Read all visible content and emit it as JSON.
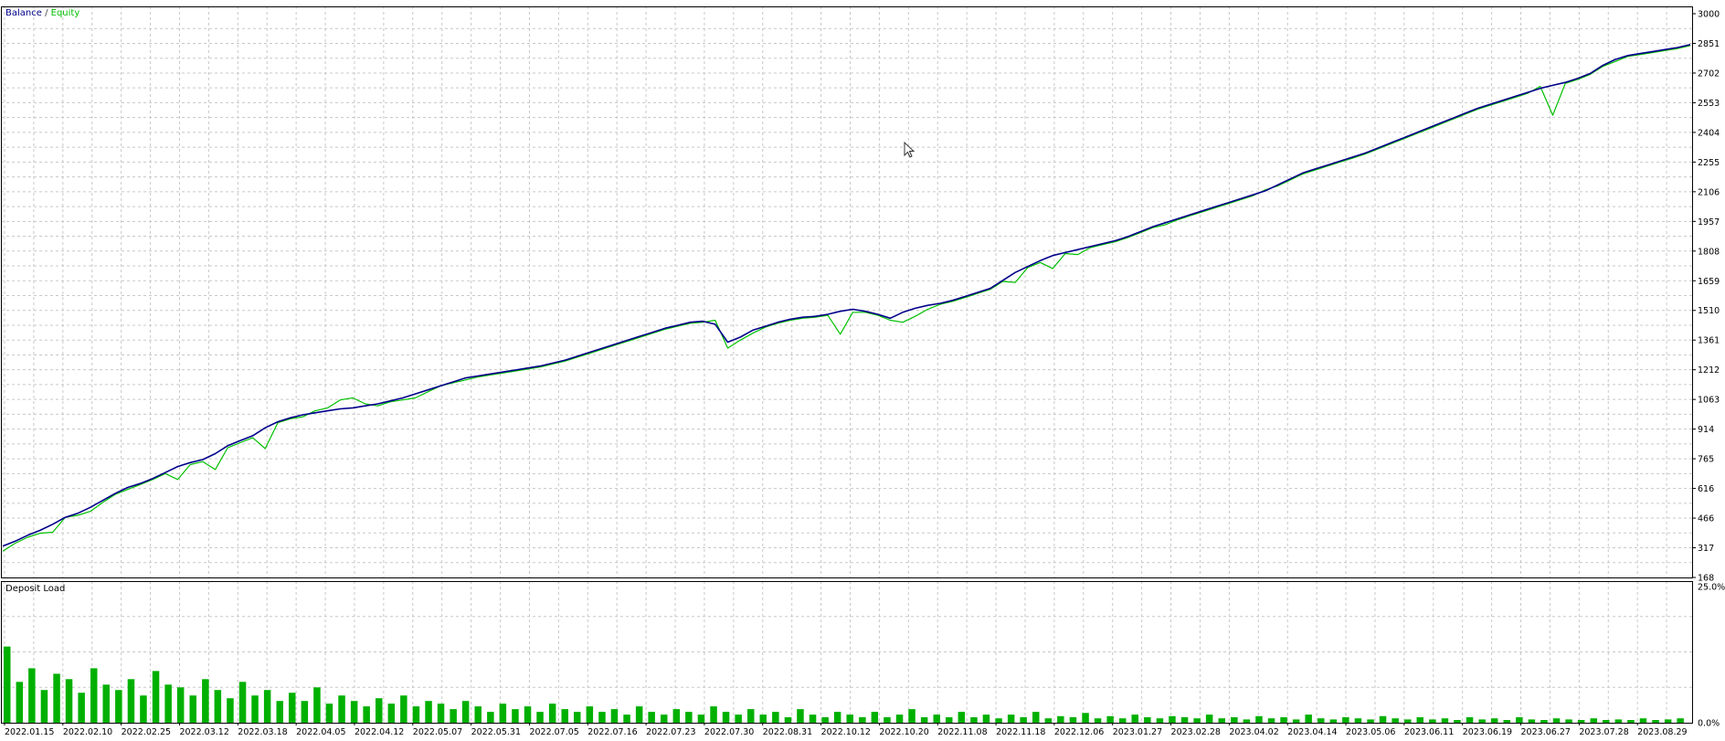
{
  "chart_data": [
    {
      "type": "line",
      "legend": {
        "placement": "top-left",
        "separator": " / "
      },
      "series": [
        {
          "name": "Balance",
          "color": "#00008b",
          "values": [
            325,
            350,
            380,
            405,
            435,
            470,
            490,
            520,
            555,
            590,
            620,
            640,
            665,
            695,
            725,
            745,
            760,
            790,
            830,
            855,
            880,
            920,
            950,
            970,
            985,
            995,
            1005,
            1015,
            1020,
            1030,
            1040,
            1055,
            1070,
            1090,
            1110,
            1130,
            1150,
            1170,
            1180,
            1190,
            1200,
            1210,
            1220,
            1230,
            1245,
            1260,
            1280,
            1300,
            1320,
            1340,
            1360,
            1380,
            1400,
            1420,
            1435,
            1450,
            1455,
            1440,
            1350,
            1375,
            1410,
            1430,
            1450,
            1465,
            1475,
            1480,
            1490,
            1505,
            1515,
            1505,
            1490,
            1470,
            1500,
            1520,
            1535,
            1545,
            1560,
            1580,
            1600,
            1620,
            1660,
            1700,
            1730,
            1760,
            1785,
            1800,
            1815,
            1830,
            1845,
            1860,
            1880,
            1905,
            1930,
            1950,
            1970,
            1990,
            2010,
            2030,
            2050,
            2070,
            2090,
            2110,
            2140,
            2170,
            2200,
            2220,
            2240,
            2260,
            2280,
            2300,
            2325,
            2350,
            2375,
            2400,
            2425,
            2450,
            2475,
            2500,
            2525,
            2545,
            2565,
            2585,
            2605,
            2625,
            2640,
            2655,
            2675,
            2700,
            2740,
            2770,
            2790,
            2800,
            2810,
            2820,
            2830,
            2845
          ]
        },
        {
          "name": "Equity",
          "color": "#00c000",
          "values": [
            300,
            340,
            370,
            390,
            395,
            470,
            480,
            500,
            545,
            585,
            610,
            635,
            660,
            690,
            660,
            735,
            750,
            710,
            820,
            845,
            870,
            815,
            945,
            965,
            975,
            1005,
            1020,
            1060,
            1070,
            1040,
            1030,
            1050,
            1060,
            1070,
            1100,
            1130,
            1145,
            1160,
            1175,
            1185,
            1195,
            1205,
            1215,
            1225,
            1240,
            1255,
            1275,
            1295,
            1315,
            1335,
            1355,
            1375,
            1395,
            1415,
            1430,
            1445,
            1450,
            1460,
            1320,
            1360,
            1395,
            1425,
            1445,
            1460,
            1470,
            1475,
            1485,
            1390,
            1500,
            1500,
            1485,
            1460,
            1450,
            1480,
            1515,
            1540,
            1555,
            1575,
            1595,
            1615,
            1655,
            1650,
            1725,
            1750,
            1720,
            1795,
            1790,
            1825,
            1840,
            1855,
            1875,
            1900,
            1925,
            1940,
            1965,
            1985,
            2005,
            2025,
            2045,
            2065,
            2085,
            2115,
            2135,
            2165,
            2195,
            2215,
            2235,
            2255,
            2275,
            2295,
            2320,
            2345,
            2370,
            2395,
            2420,
            2445,
            2470,
            2495,
            2520,
            2540,
            2560,
            2580,
            2600,
            2635,
            2490,
            2650,
            2670,
            2695,
            2735,
            2760,
            2785,
            2795,
            2805,
            2815,
            2825,
            2840
          ]
        }
      ],
      "ylim": [
        168,
        3000
      ],
      "y_ticks": [
        "3000",
        "2851",
        "2702",
        "2553",
        "2404",
        "2255",
        "2106",
        "1957",
        "1808",
        "1659",
        "1510",
        "1361",
        "1212",
        "1063",
        "914",
        "765",
        "616",
        "466",
        "317",
        "168"
      ],
      "grid": true
    },
    {
      "type": "bar",
      "title": "Deposit Load",
      "series": [
        {
          "name": "Deposit Load",
          "color": "#00b000",
          "values": [
            14.0,
            7.5,
            10.0,
            6.0,
            9.0,
            8.0,
            5.5,
            10.0,
            7.0,
            6.0,
            8.0,
            5.0,
            9.5,
            7.0,
            6.5,
            5.0,
            8.0,
            6.0,
            4.5,
            7.5,
            5.0,
            6.0,
            4.0,
            5.5,
            4.0,
            6.5,
            3.5,
            5.0,
            4.0,
            3.0,
            4.5,
            3.5,
            5.0,
            3.0,
            4.0,
            3.5,
            2.5,
            4.0,
            3.0,
            2.0,
            3.5,
            2.5,
            3.0,
            2.0,
            3.5,
            2.5,
            2.0,
            3.0,
            2.0,
            2.5,
            1.5,
            3.0,
            2.0,
            1.5,
            2.5,
            2.0,
            1.5,
            3.0,
            2.0,
            1.5,
            2.5,
            1.5,
            2.0,
            1.0,
            2.5,
            1.5,
            1.0,
            2.0,
            1.5,
            1.0,
            2.0,
            1.0,
            1.5,
            2.5,
            1.0,
            1.5,
            1.0,
            2.0,
            1.0,
            1.5,
            0.8,
            1.5,
            1.0,
            2.0,
            0.8,
            1.2,
            1.0,
            1.8,
            0.8,
            1.2,
            0.8,
            1.5,
            1.0,
            0.8,
            1.2,
            1.0,
            0.8,
            1.5,
            0.8,
            1.0,
            0.6,
            1.2,
            0.8,
            1.0,
            0.6,
            1.5,
            0.8,
            0.6,
            1.0,
            0.8,
            0.6,
            1.2,
            0.8,
            0.6,
            1.0,
            0.6,
            0.8,
            0.5,
            1.0,
            0.6,
            0.8,
            0.5,
            1.0,
            0.6,
            0.5,
            0.8,
            0.6,
            0.5,
            0.8,
            0.5,
            0.6,
            0.5,
            0.8,
            0.5,
            0.6,
            0.8
          ]
        }
      ],
      "ylim": [
        0,
        25
      ],
      "y_ticks": [
        "25.0%",
        "0.0%"
      ],
      "grid": true
    }
  ],
  "x_tick_labels": [
    "2022.01.15",
    "2022.02.10",
    "2022.02.25",
    "2022.03.12",
    "2022.03.18",
    "2022.04.05",
    "2022.04.12",
    "2022.05.07",
    "2022.05.31",
    "2022.07.05",
    "2022.07.16",
    "2022.07.23",
    "2022.07.30",
    "2022.08.31",
    "2022.10.12",
    "2022.10.20",
    "2022.11.08",
    "2022.11.18",
    "2022.12.06",
    "2023.01.27",
    "2023.02.28",
    "2023.04.02",
    "2023.04.14",
    "2023.05.06",
    "2023.06.11",
    "2023.06.19",
    "2023.06.27",
    "2023.07.28",
    "2023.08.29"
  ],
  "colors": {
    "background": "#ffffff",
    "frame": "#000000",
    "grid": "#c8c8c8",
    "text": "#000000"
  },
  "cursor_icon": "mouse-pointer-arrow"
}
